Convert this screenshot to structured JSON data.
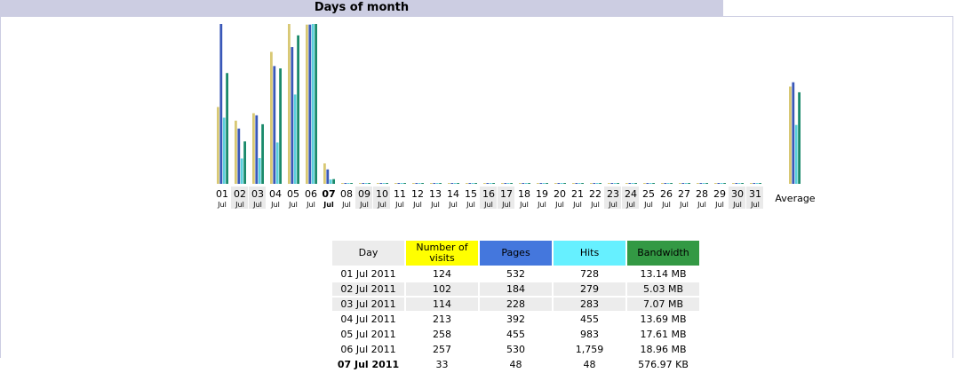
{
  "section_title": "Days of month",
  "colors": {
    "visits": "#d8c874",
    "pages": "#3a58b8",
    "hits": "#5ad0dc",
    "bandwidth": "#1a8a6a",
    "weekend_bg": "#eaeaea"
  },
  "chart_data": {
    "type": "bar",
    "title": "",
    "categories": [
      "01",
      "02",
      "03",
      "04",
      "05",
      "06",
      "07",
      "08",
      "09",
      "10",
      "11",
      "12",
      "13",
      "14",
      "15",
      "16",
      "17",
      "18",
      "19",
      "20",
      "21",
      "22",
      "23",
      "24",
      "25",
      "26",
      "27",
      "28",
      "29",
      "30",
      "31"
    ],
    "month_label": "Jul",
    "weekend_days": [
      "02",
      "03",
      "09",
      "10",
      "16",
      "17",
      "23",
      "24",
      "30",
      "31"
    ],
    "bold_day": "07",
    "average_label": "Average",
    "series": [
      {
        "name": "Number of visits",
        "values": [
          124,
          102,
          114,
          213,
          258,
          257,
          33,
          0,
          0,
          0,
          0,
          0,
          0,
          0,
          0,
          0,
          0,
          0,
          0,
          0,
          0,
          0,
          0,
          0,
          0,
          0,
          0,
          0,
          0,
          0,
          0
        ],
        "average": 157
      },
      {
        "name": "Pages",
        "values": [
          532,
          184,
          228,
          392,
          455,
          530,
          48,
          0,
          0,
          0,
          0,
          0,
          0,
          0,
          0,
          0,
          0,
          0,
          0,
          0,
          0,
          0,
          0,
          0,
          0,
          0,
          0,
          0,
          0,
          0,
          0
        ],
        "average": 338
      },
      {
        "name": "Hits",
        "values": [
          728,
          279,
          283,
          455,
          983,
          1759,
          48,
          0,
          0,
          0,
          0,
          0,
          0,
          0,
          0,
          0,
          0,
          0,
          0,
          0,
          0,
          0,
          0,
          0,
          0,
          0,
          0,
          0,
          0,
          0,
          0
        ],
        "average": 648
      },
      {
        "name": "Bandwidth",
        "values": [
          13.14,
          5.03,
          7.07,
          13.69,
          17.61,
          18.96,
          0.56,
          0,
          0,
          0,
          0,
          0,
          0,
          0,
          0,
          0,
          0,
          0,
          0,
          0,
          0,
          0,
          0,
          0,
          0,
          0,
          0,
          0,
          0,
          0,
          0
        ],
        "average": 10.86
      }
    ]
  },
  "table": {
    "headers": [
      "Day",
      "Number of visits",
      "Pages",
      "Hits",
      "Bandwidth"
    ],
    "rows": [
      [
        "01 Jul 2011",
        "124",
        "532",
        "728",
        "13.14 MB"
      ],
      [
        "02 Jul 2011",
        "102",
        "184",
        "279",
        "5.03 MB"
      ],
      [
        "03 Jul 2011",
        "114",
        "228",
        "283",
        "7.07 MB"
      ],
      [
        "04 Jul 2011",
        "213",
        "392",
        "455",
        "13.69 MB"
      ],
      [
        "05 Jul 2011",
        "258",
        "455",
        "983",
        "17.61 MB"
      ],
      [
        "06 Jul 2011",
        "257",
        "530",
        "1,759",
        "18.96 MB"
      ],
      [
        "07 Jul 2011",
        "33",
        "48",
        "48",
        "576.97 KB"
      ]
    ]
  }
}
